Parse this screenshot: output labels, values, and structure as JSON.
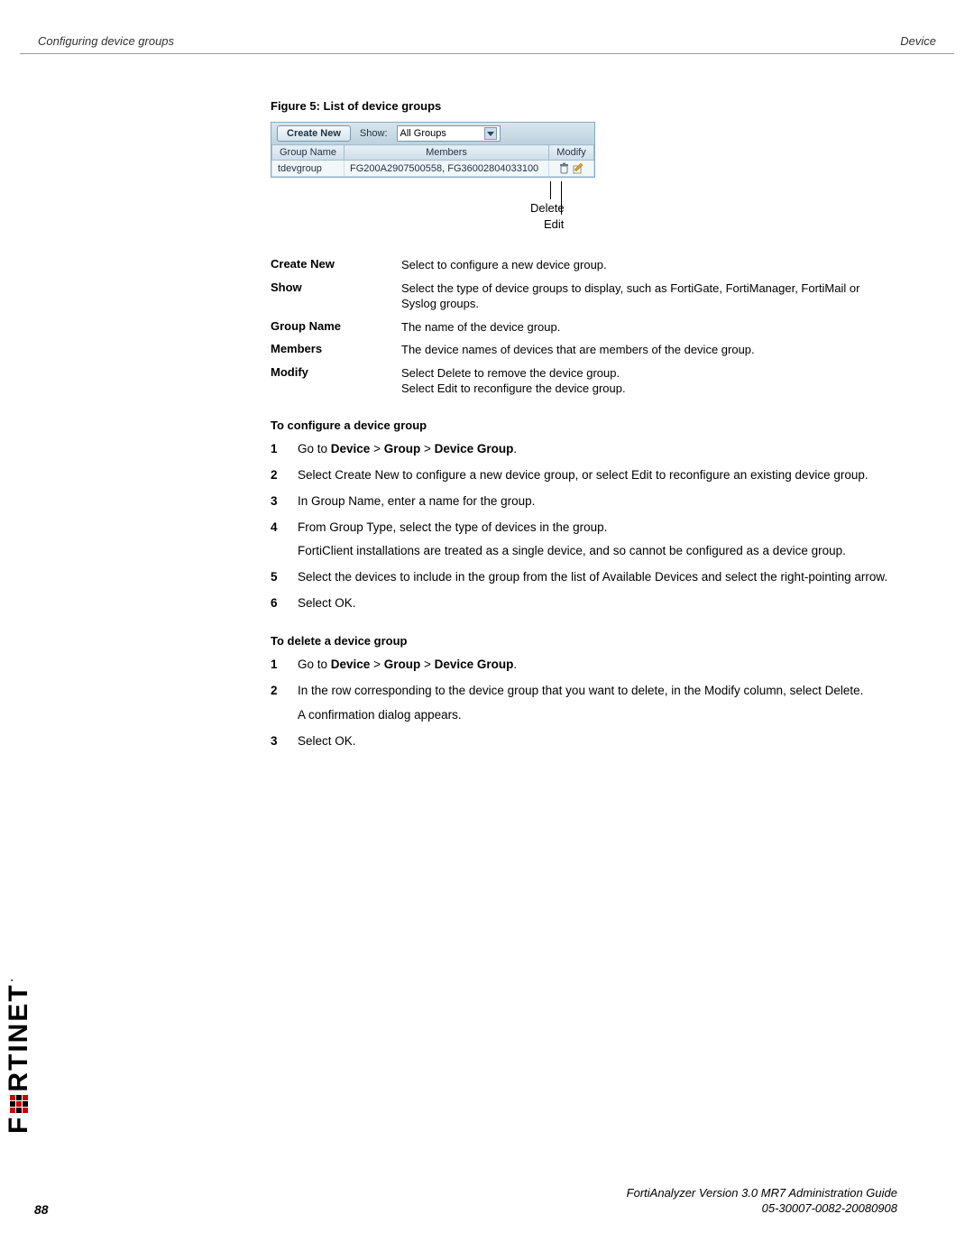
{
  "header": {
    "left": "Configuring device groups",
    "right": "Device"
  },
  "figure_caption": "Figure 5:   List of device groups",
  "ui": {
    "create_new": "Create New",
    "show_label": "Show:",
    "show_value": "All Groups",
    "columns": {
      "group_name": "Group Name",
      "members": "Members",
      "modify": "Modify"
    },
    "row": {
      "group_name": "tdevgroup",
      "members": "FG200A2907500558, FG36002804033100"
    }
  },
  "callouts": {
    "delete": "Delete",
    "edit": "Edit"
  },
  "descriptions": [
    {
      "term": "Create New",
      "def": "Select to configure a new device group."
    },
    {
      "term": "Show",
      "def": "Select the type of device groups to display, such as FortiGate, FortiManager, FortiMail or Syslog groups."
    },
    {
      "term": "Group Name",
      "def": "The name of the device group."
    },
    {
      "term": "Members",
      "def": "The device names of devices that are members of the device group."
    },
    {
      "term": "Modify",
      "def": "Select Delete to remove the device group.\nSelect Edit to reconfigure the device group."
    }
  ],
  "configure_heading": "To configure a device group",
  "configure_steps": [
    {
      "num": "1",
      "html": "Go to <b>Device</b> > <b>Group</b> > <b>Device Group</b>."
    },
    {
      "num": "2",
      "html": "Select Create New to configure a new device group, or select Edit to reconfigure an existing device group."
    },
    {
      "num": "3",
      "html": "In Group Name, enter a name for the group."
    },
    {
      "num": "4",
      "html": "From Group Type, select the type of devices in the group.",
      "sub": "FortiClient installations are treated as a single device, and so cannot be configured as a device group."
    },
    {
      "num": "5",
      "html": "Select the devices to include in the group from the list of Available Devices and select the right-pointing arrow."
    },
    {
      "num": "6",
      "html": "Select OK."
    }
  ],
  "delete_heading": "To delete a device group",
  "delete_steps": [
    {
      "num": "1",
      "html": "Go to <b>Device</b> > <b>Group</b> > <b>Device Group</b>."
    },
    {
      "num": "2",
      "html": "In the row corresponding to the device group that you want to delete, in the Modify column, select Delete.",
      "sub": "A confirmation dialog appears."
    },
    {
      "num": "3",
      "html": "Select OK."
    }
  ],
  "logo_text_left": "F",
  "logo_text_right": "RTINET",
  "footer": {
    "page": "88",
    "line1": "FortiAnalyzer Version 3.0 MR7 Administration Guide",
    "line2": "05-30007-0082-20080908"
  }
}
